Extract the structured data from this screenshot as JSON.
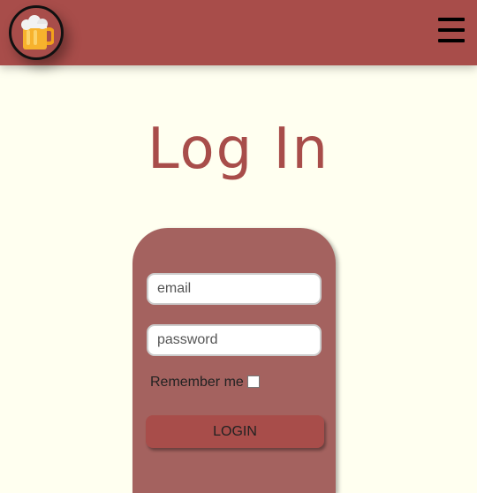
{
  "header": {
    "logo_icon": "beer-mug-icon",
    "menu_icon": "hamburger-menu-icon"
  },
  "page": {
    "title": "Log In"
  },
  "form": {
    "email_placeholder": "email",
    "password_placeholder": "password",
    "remember_label": "Remember me",
    "remember_checked": false,
    "login_label": "LOGIN"
  },
  "colors": {
    "header_bg": "#a84d4a",
    "page_bg": "#fffff0",
    "card_bg": "#a4625f",
    "title": "#a84d4a",
    "button_bg": "#a84d4a"
  }
}
